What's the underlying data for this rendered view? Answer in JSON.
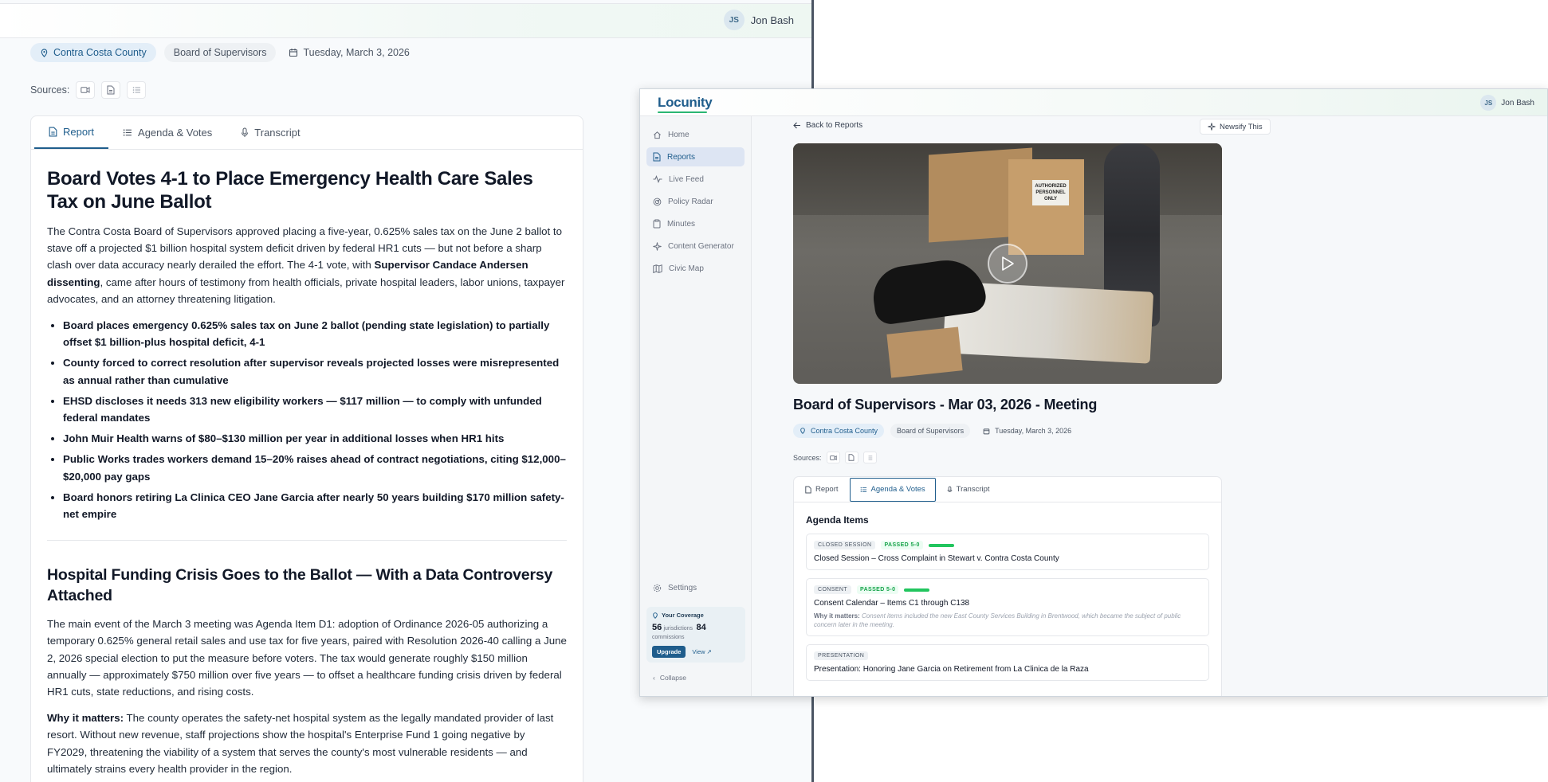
{
  "left": {
    "user": {
      "initials": "JS",
      "name": "Jon Bash"
    },
    "meta": {
      "county": "Contra Costa County",
      "board": "Board of Supervisors",
      "date": "Tuesday, March 3, 2026"
    },
    "sources_label": "Sources:",
    "tabs": [
      {
        "label": "Report"
      },
      {
        "label": "Agenda & Votes"
      },
      {
        "label": "Transcript"
      }
    ],
    "article": {
      "headline": "Board Votes 4-1 to Place Emergency Health Care Sales Tax on June Ballot",
      "intro_a": "The Contra Costa Board of Supervisors approved placing a five-year, 0.625% sales tax on the June 2 ballot to stave off a projected $1 billion hospital system deficit driven by federal HR1 cuts — but not before a sharp clash over data accuracy nearly derailed the effort. The 4-1 vote, with ",
      "intro_bold": "Supervisor Candace Andersen dissenting",
      "intro_b": ", came after hours of testimony from health officials, private hospital leaders, labor unions, taxpayer advocates, and an attorney threatening litigation.",
      "bullets": [
        "Board places emergency 0.625% sales tax on June 2 ballot (pending state legislation) to partially offset $1 billion-plus hospital deficit, 4-1",
        "County forced to correct resolution after supervisor reveals projected losses were misrepresented as annual rather than cumulative",
        "EHSD discloses it needs 313 new eligibility workers — $117 million — to comply with unfunded federal mandates",
        "John Muir Health warns of $80–$130 million per year in additional losses when HR1 hits",
        "Public Works trades workers demand 15–20% raises ahead of contract negotiations, citing $12,000–$20,000 pay gaps",
        "Board honors retiring La Clinica CEO Jane Garcia after nearly 50 years building $170 million safety-net empire"
      ],
      "section_heading": "Hospital Funding Crisis Goes to the Ballot — With a Data Controversy Attached",
      "section_p1": "The main event of the March 3 meeting was Agenda Item D1: adoption of Ordinance 2026-05 authorizing a temporary 0.625% general retail sales and use tax for five years, paired with Resolution 2026-40 calling a June 2, 2026 special election to put the measure before voters. The tax would generate roughly $150 million annually — approximately $750 million over five years — to offset a healthcare funding crisis driven by federal HR1 cuts, state reductions, and rising costs.",
      "why_label": "Why it matters:",
      "why_text": " The county operates the safety-net hospital system as the legally mandated provider of last resort. Without new revenue, staff projections show the hospital's Enterprise Fund 1 going negative by FY2029, threatening the viability of a system that serves the county's most vulnerable residents — and ultimately strains every health provider in the region."
    }
  },
  "right": {
    "logo": "Locunity",
    "user": {
      "initials": "JS",
      "name": "Jon Bash"
    },
    "nav": [
      {
        "label": "Home",
        "icon": "home-icon"
      },
      {
        "label": "Reports",
        "icon": "document-icon"
      },
      {
        "label": "Live Feed",
        "icon": "pulse-icon"
      },
      {
        "label": "Policy Radar",
        "icon": "radar-icon"
      },
      {
        "label": "Minutes",
        "icon": "clipboard-icon"
      },
      {
        "label": "Content Generator",
        "icon": "sparkle-icon"
      },
      {
        "label": "Civic Map",
        "icon": "map-icon"
      }
    ],
    "settings_label": "Settings",
    "coverage": {
      "title": "Your Coverage",
      "jurisdictions_count": "56",
      "jurisdictions_label": "jurisdictions",
      "commissions_count": "84",
      "commissions_label": "commissions",
      "upgrade_label": "Upgrade",
      "view_label": "View"
    },
    "collapse_label": "Collapse",
    "back_label": "Back to Reports",
    "newsify_label": "Newsify This",
    "video_sign": "AUTHORIZED PERSONNEL ONLY",
    "meeting_title": "Board of Supervisors - Mar 03, 2026 - Meeting",
    "meta": {
      "county": "Contra Costa County",
      "board": "Board of Supervisors",
      "date": "Tuesday, March 3, 2026"
    },
    "sources_label": "Sources:",
    "tabs": [
      {
        "label": "Report"
      },
      {
        "label": "Agenda & Votes"
      },
      {
        "label": "Transcript"
      }
    ],
    "agenda_heading": "Agenda Items",
    "agenda_items": [
      {
        "tag": "CLOSED SESSION",
        "status": "PASSED 5-0",
        "title": "Closed Session – Cross Complaint in Stewart v. Contra Costa County"
      },
      {
        "tag": "CONSENT",
        "status": "PASSED 5-0",
        "title": "Consent Calendar – Items C1 through C138",
        "why_label": "Why it matters:",
        "why_text": "Consent items included the new East County Services Building in Brentwood, which became the subject of public concern later in the meeting."
      },
      {
        "tag": "PRESENTATION",
        "title": "Presentation: Honoring Jane Garcia on Retirement from La Clinica de la Raza"
      }
    ],
    "colors": {
      "brand": "#1f5d8c",
      "accent": "#2bb673",
      "pass": "#16a34a"
    }
  }
}
